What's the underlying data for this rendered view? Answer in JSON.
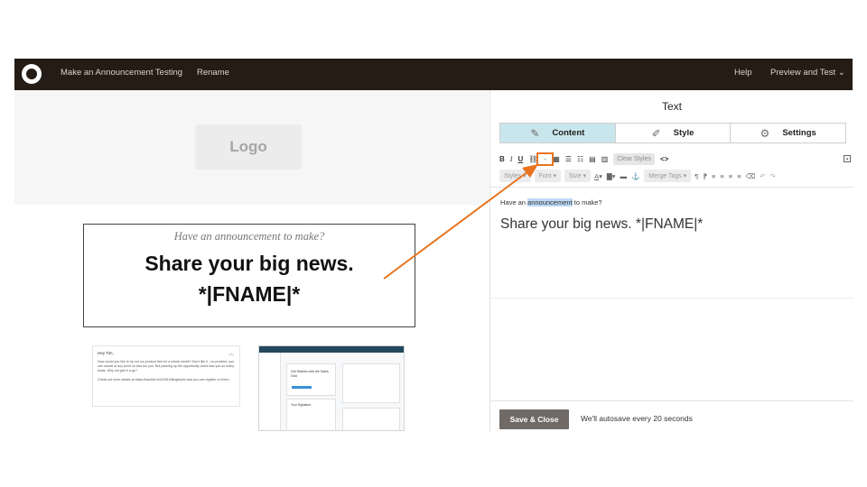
{
  "topbar": {
    "title": "Make an Announcement Testing",
    "rename": "Rename",
    "help": "Help",
    "preview": "Preview and Test",
    "preview_caret": "⌄"
  },
  "canvas": {
    "logo_placeholder": "Logo",
    "text_block": {
      "subheading": "Have an announcement to make?",
      "heading": "Share your big news. *|FNAME|*"
    },
    "thumb_email": {
      "greeting": "Hey Tim,",
      "body": "How would you like to try out our product free for a whole month? Don't like it - no problem; you can cancel at any point no loss too you. But passing up the opportunity could lose you so many leads. Why not give it a go?",
      "body2": "Check out more details at https://kamidit.io/423610/langleytim and you can register on there."
    },
    "thumb_app": {
      "card_title": "Get Started with the Sales Grid",
      "section": "Your Signature"
    }
  },
  "panel": {
    "title": "Text",
    "tabs": [
      {
        "label": "Content",
        "icon": "pencil-icon",
        "active": true
      },
      {
        "label": "Style",
        "icon": "brush-icon",
        "active": false
      },
      {
        "label": "Settings",
        "icon": "gear-icon",
        "active": false
      }
    ],
    "toolbar1": {
      "bold": "B",
      "italic": "I",
      "underline": "U",
      "clear_styles": "Clear Styles",
      "source": "<>"
    },
    "toolbar2": {
      "styles": "Styles",
      "font": "Font",
      "size": "Size",
      "merge_tags": "Merge Tags"
    },
    "editor": {
      "sub_before": "Have an ",
      "sub_highlight": "announcement",
      "sub_after": " to make?",
      "heading": "Share your big news. *|FNAME|*"
    },
    "footer": {
      "save_label": "Save & Close",
      "autosave_text": "We'll autosave every 20 seconds"
    }
  },
  "annotation": {
    "color": "#e8741f"
  }
}
